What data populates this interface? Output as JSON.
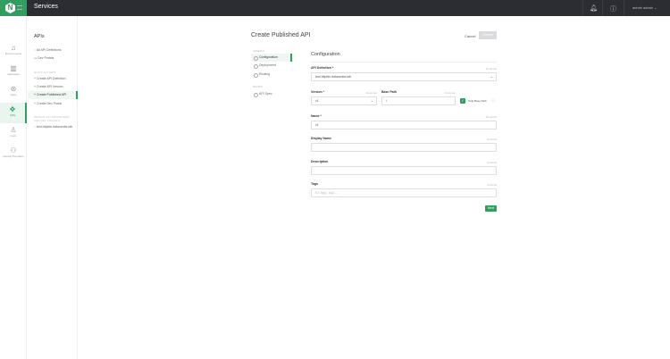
{
  "header": {
    "logo": "N",
    "title": "Services",
    "user": "admin admin"
  },
  "rail": [
    {
      "icon": "bell",
      "label": "Environments"
    },
    {
      "icon": "gateway",
      "label": "Gateways"
    },
    {
      "icon": "apps",
      "label": "Apps"
    },
    {
      "icon": "apis",
      "label": "APIs"
    },
    {
      "icon": "cert",
      "label": "Certs"
    },
    {
      "icon": "identity",
      "label": "Identity Providers"
    }
  ],
  "sidebar": {
    "title": "APIs",
    "items": [
      "All API Definitions",
      "Dev Portals"
    ],
    "quick_actions_heading": "QUICK ACTIONS",
    "quick_actions": [
      "Create API Definition",
      "Create API Version",
      "Create Published API",
      "Create Dev Portal"
    ],
    "recent_heading_1": "RECENT API DEFINITIONS",
    "recent_heading_2": "AND DEV PORTALS",
    "recent": [
      "test.httpbin.datacenter.lab"
    ]
  },
  "page": {
    "title": "Create Published API",
    "cancel": "Cancel",
    "submit": "Submit"
  },
  "steps": {
    "general_heading": "GENERAL",
    "general": [
      "Configuration",
      "Deployment",
      "Routing"
    ],
    "review_heading": "REVIEW",
    "review": [
      "API Spec"
    ]
  },
  "form": {
    "section": "Configuration",
    "required": "Required",
    "optional": "Optional",
    "api_definition": {
      "label": "API Definition *",
      "value": "test.httpbin.datacenter.lab"
    },
    "version": {
      "label": "Version *",
      "value": "v1"
    },
    "base_path": {
      "label": "Base Path",
      "value": "/"
    },
    "strip_base_path": {
      "label": "Strip Base Path",
      "checked": true
    },
    "name": {
      "label": "Name *",
      "value": "v1"
    },
    "display_name": {
      "label": "Display Name",
      "value": ""
    },
    "description": {
      "label": "Description",
      "value": ""
    },
    "tags": {
      "label": "Tags",
      "placeholder": "Ex: tag1, tag2, ..."
    },
    "next": "Next"
  },
  "colors": {
    "accent": "#2f9e5e",
    "header": "#2b2d33"
  }
}
